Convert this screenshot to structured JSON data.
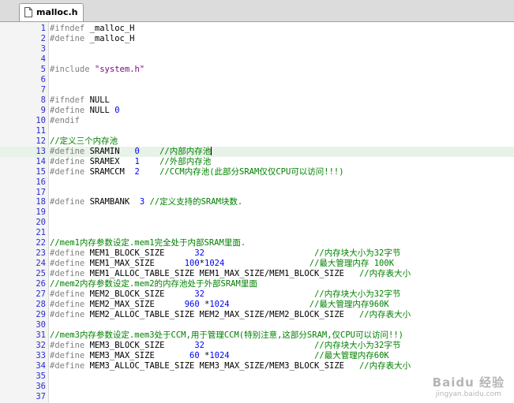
{
  "tab": {
    "label": "malloc.h",
    "icon": "file-icon"
  },
  "code_lines": [
    {
      "n": "1",
      "parts": [
        {
          "t": "#ifndef",
          "c": "pp"
        },
        {
          "t": " _malloc_H",
          "c": ""
        }
      ]
    },
    {
      "n": "2",
      "parts": [
        {
          "t": "#define",
          "c": "pp"
        },
        {
          "t": " _malloc_H",
          "c": ""
        }
      ]
    },
    {
      "n": "3",
      "parts": []
    },
    {
      "n": "4",
      "parts": []
    },
    {
      "n": "5",
      "parts": [
        {
          "t": "#include",
          "c": "pp"
        },
        {
          "t": " ",
          "c": ""
        },
        {
          "t": "\"system.h\"",
          "c": "str"
        }
      ]
    },
    {
      "n": "6",
      "parts": []
    },
    {
      "n": "7",
      "parts": []
    },
    {
      "n": "8",
      "parts": [
        {
          "t": "#ifndef",
          "c": "pp"
        },
        {
          "t": " NULL",
          "c": ""
        }
      ]
    },
    {
      "n": "9",
      "parts": [
        {
          "t": "#define",
          "c": "pp"
        },
        {
          "t": " NULL ",
          "c": ""
        },
        {
          "t": "0",
          "c": "num"
        }
      ]
    },
    {
      "n": "10",
      "parts": [
        {
          "t": "#endif",
          "c": "pp"
        }
      ]
    },
    {
      "n": "11",
      "parts": []
    },
    {
      "n": "12",
      "parts": [
        {
          "t": "//定义三个内存池",
          "c": "cm"
        }
      ]
    },
    {
      "n": "13",
      "current": true,
      "parts": [
        {
          "t": "#define",
          "c": "pp"
        },
        {
          "t": " SRAMIN   ",
          "c": ""
        },
        {
          "t": "0",
          "c": "num"
        },
        {
          "t": "    ",
          "c": ""
        },
        {
          "t": "//内部内存池",
          "c": "cm"
        }
      ]
    },
    {
      "n": "14",
      "parts": [
        {
          "t": "#define",
          "c": "pp"
        },
        {
          "t": " SRAMEX   ",
          "c": ""
        },
        {
          "t": "1",
          "c": "num"
        },
        {
          "t": "    ",
          "c": ""
        },
        {
          "t": "//外部内存池",
          "c": "cm"
        }
      ]
    },
    {
      "n": "15",
      "parts": [
        {
          "t": "#define",
          "c": "pp"
        },
        {
          "t": " SRAMCCM  ",
          "c": ""
        },
        {
          "t": "2",
          "c": "num"
        },
        {
          "t": "    ",
          "c": ""
        },
        {
          "t": "//CCM内存池(此部分SRAM仅仅CPU可以访问!!!)",
          "c": "cm"
        }
      ]
    },
    {
      "n": "16",
      "parts": []
    },
    {
      "n": "17",
      "parts": []
    },
    {
      "n": "18",
      "parts": [
        {
          "t": "#define",
          "c": "pp"
        },
        {
          "t": " SRAMBANK  ",
          "c": ""
        },
        {
          "t": "3",
          "c": "num"
        },
        {
          "t": " ",
          "c": ""
        },
        {
          "t": "//定义支持的SRAM块数.",
          "c": "cm"
        }
      ]
    },
    {
      "n": "19",
      "parts": []
    },
    {
      "n": "20",
      "parts": []
    },
    {
      "n": "21",
      "parts": []
    },
    {
      "n": "22",
      "parts": [
        {
          "t": "//mem1内存参数设定.mem1完全处于内部SRAM里面.",
          "c": "cm"
        }
      ]
    },
    {
      "n": "23",
      "parts": [
        {
          "t": "#define",
          "c": "pp"
        },
        {
          "t": " MEM1_BLOCK_SIZE      ",
          "c": ""
        },
        {
          "t": "32",
          "c": "num"
        },
        {
          "t": "                      ",
          "c": ""
        },
        {
          "t": "//内存块大小为32字节",
          "c": "cm"
        }
      ]
    },
    {
      "n": "24",
      "parts": [
        {
          "t": "#define",
          "c": "pp"
        },
        {
          "t": " MEM1_MAX_SIZE      ",
          "c": ""
        },
        {
          "t": "100",
          "c": "num"
        },
        {
          "t": "*",
          "c": ""
        },
        {
          "t": "1024",
          "c": "num"
        },
        {
          "t": "                 ",
          "c": ""
        },
        {
          "t": "//最大管理内存 100K",
          "c": "cm"
        }
      ]
    },
    {
      "n": "25",
      "parts": [
        {
          "t": "#define",
          "c": "pp"
        },
        {
          "t": " MEM1_ALLOC_TABLE_SIZE MEM1_MAX_SIZE/MEM1_BLOCK_SIZE   ",
          "c": ""
        },
        {
          "t": "//内存表大小",
          "c": "cm"
        }
      ]
    },
    {
      "n": "26",
      "parts": [
        {
          "t": "//mem2内存参数设定.mem2的内存池处于外部SRAM里面",
          "c": "cm"
        }
      ]
    },
    {
      "n": "27",
      "parts": [
        {
          "t": "#define",
          "c": "pp"
        },
        {
          "t": " MEM2_BLOCK_SIZE      ",
          "c": ""
        },
        {
          "t": "32",
          "c": "num"
        },
        {
          "t": "                      ",
          "c": ""
        },
        {
          "t": "//内存块大小为32字节",
          "c": "cm"
        }
      ]
    },
    {
      "n": "28",
      "parts": [
        {
          "t": "#define",
          "c": "pp"
        },
        {
          "t": " MEM2_MAX_SIZE      ",
          "c": ""
        },
        {
          "t": "960",
          "c": "num"
        },
        {
          "t": " *",
          "c": ""
        },
        {
          "t": "1024",
          "c": "num"
        },
        {
          "t": "                ",
          "c": ""
        },
        {
          "t": "//最大管理内存960K",
          "c": "cm"
        }
      ]
    },
    {
      "n": "29",
      "parts": [
        {
          "t": "#define",
          "c": "pp"
        },
        {
          "t": " MEM2_ALLOC_TABLE_SIZE MEM2_MAX_SIZE/MEM2_BLOCK_SIZE   ",
          "c": ""
        },
        {
          "t": "//内存表大小",
          "c": "cm"
        }
      ]
    },
    {
      "n": "30",
      "parts": []
    },
    {
      "n": "31",
      "parts": [
        {
          "t": "//mem3内存参数设定.mem3处于CCM,用于管理CCM(特别注意,这部分SRAM,仅CPU可以访问!!)",
          "c": "cm"
        }
      ]
    },
    {
      "n": "32",
      "parts": [
        {
          "t": "#define",
          "c": "pp"
        },
        {
          "t": " MEM3_BLOCK_SIZE      ",
          "c": ""
        },
        {
          "t": "32",
          "c": "num"
        },
        {
          "t": "                      ",
          "c": ""
        },
        {
          "t": "//内存块大小为32字节",
          "c": "cm"
        }
      ]
    },
    {
      "n": "33",
      "parts": [
        {
          "t": "#define",
          "c": "pp"
        },
        {
          "t": " MEM3_MAX_SIZE       ",
          "c": ""
        },
        {
          "t": "60",
          "c": "num"
        },
        {
          "t": " *",
          "c": ""
        },
        {
          "t": "1024",
          "c": "num"
        },
        {
          "t": "                 ",
          "c": ""
        },
        {
          "t": "//最大管理内存60K",
          "c": "cm"
        }
      ]
    },
    {
      "n": "34",
      "parts": [
        {
          "t": "#define",
          "c": "pp"
        },
        {
          "t": " MEM3_ALLOC_TABLE_SIZE MEM3_MAX_SIZE/MEM3_BLOCK_SIZE   ",
          "c": ""
        },
        {
          "t": "//内存表大小",
          "c": "cm"
        }
      ]
    },
    {
      "n": "35",
      "parts": []
    },
    {
      "n": "36",
      "parts": []
    },
    {
      "n": "37",
      "parts": []
    }
  ],
  "watermark": {
    "line1": "Baidu 经验",
    "line2": "jingyan.baidu.com"
  }
}
